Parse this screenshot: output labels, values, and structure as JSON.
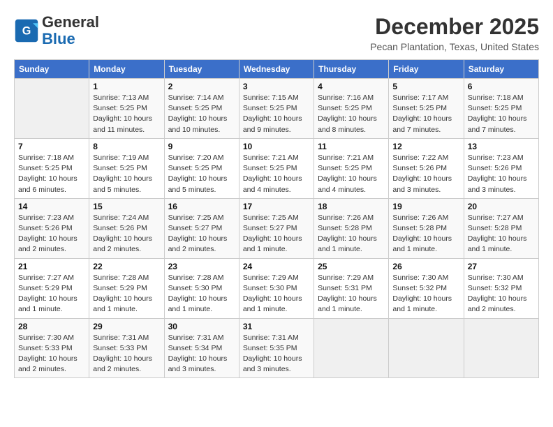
{
  "header": {
    "logo_line1": "General",
    "logo_line2": "Blue",
    "month_year": "December 2025",
    "location": "Pecan Plantation, Texas, United States"
  },
  "days_of_week": [
    "Sunday",
    "Monday",
    "Tuesday",
    "Wednesday",
    "Thursday",
    "Friday",
    "Saturday"
  ],
  "weeks": [
    [
      {
        "day": "",
        "detail": ""
      },
      {
        "day": "1",
        "detail": "Sunrise: 7:13 AM\nSunset: 5:25 PM\nDaylight: 10 hours\nand 11 minutes."
      },
      {
        "day": "2",
        "detail": "Sunrise: 7:14 AM\nSunset: 5:25 PM\nDaylight: 10 hours\nand 10 minutes."
      },
      {
        "day": "3",
        "detail": "Sunrise: 7:15 AM\nSunset: 5:25 PM\nDaylight: 10 hours\nand 9 minutes."
      },
      {
        "day": "4",
        "detail": "Sunrise: 7:16 AM\nSunset: 5:25 PM\nDaylight: 10 hours\nand 8 minutes."
      },
      {
        "day": "5",
        "detail": "Sunrise: 7:17 AM\nSunset: 5:25 PM\nDaylight: 10 hours\nand 7 minutes."
      },
      {
        "day": "6",
        "detail": "Sunrise: 7:18 AM\nSunset: 5:25 PM\nDaylight: 10 hours\nand 7 minutes."
      }
    ],
    [
      {
        "day": "7",
        "detail": "Sunrise: 7:18 AM\nSunset: 5:25 PM\nDaylight: 10 hours\nand 6 minutes."
      },
      {
        "day": "8",
        "detail": "Sunrise: 7:19 AM\nSunset: 5:25 PM\nDaylight: 10 hours\nand 5 minutes."
      },
      {
        "day": "9",
        "detail": "Sunrise: 7:20 AM\nSunset: 5:25 PM\nDaylight: 10 hours\nand 5 minutes."
      },
      {
        "day": "10",
        "detail": "Sunrise: 7:21 AM\nSunset: 5:25 PM\nDaylight: 10 hours\nand 4 minutes."
      },
      {
        "day": "11",
        "detail": "Sunrise: 7:21 AM\nSunset: 5:25 PM\nDaylight: 10 hours\nand 4 minutes."
      },
      {
        "day": "12",
        "detail": "Sunrise: 7:22 AM\nSunset: 5:26 PM\nDaylight: 10 hours\nand 3 minutes."
      },
      {
        "day": "13",
        "detail": "Sunrise: 7:23 AM\nSunset: 5:26 PM\nDaylight: 10 hours\nand 3 minutes."
      }
    ],
    [
      {
        "day": "14",
        "detail": "Sunrise: 7:23 AM\nSunset: 5:26 PM\nDaylight: 10 hours\nand 2 minutes."
      },
      {
        "day": "15",
        "detail": "Sunrise: 7:24 AM\nSunset: 5:26 PM\nDaylight: 10 hours\nand 2 minutes."
      },
      {
        "day": "16",
        "detail": "Sunrise: 7:25 AM\nSunset: 5:27 PM\nDaylight: 10 hours\nand 2 minutes."
      },
      {
        "day": "17",
        "detail": "Sunrise: 7:25 AM\nSunset: 5:27 PM\nDaylight: 10 hours\nand 1 minute."
      },
      {
        "day": "18",
        "detail": "Sunrise: 7:26 AM\nSunset: 5:28 PM\nDaylight: 10 hours\nand 1 minute."
      },
      {
        "day": "19",
        "detail": "Sunrise: 7:26 AM\nSunset: 5:28 PM\nDaylight: 10 hours\nand 1 minute."
      },
      {
        "day": "20",
        "detail": "Sunrise: 7:27 AM\nSunset: 5:28 PM\nDaylight: 10 hours\nand 1 minute."
      }
    ],
    [
      {
        "day": "21",
        "detail": "Sunrise: 7:27 AM\nSunset: 5:29 PM\nDaylight: 10 hours\nand 1 minute."
      },
      {
        "day": "22",
        "detail": "Sunrise: 7:28 AM\nSunset: 5:29 PM\nDaylight: 10 hours\nand 1 minute."
      },
      {
        "day": "23",
        "detail": "Sunrise: 7:28 AM\nSunset: 5:30 PM\nDaylight: 10 hours\nand 1 minute."
      },
      {
        "day": "24",
        "detail": "Sunrise: 7:29 AM\nSunset: 5:30 PM\nDaylight: 10 hours\nand 1 minute."
      },
      {
        "day": "25",
        "detail": "Sunrise: 7:29 AM\nSunset: 5:31 PM\nDaylight: 10 hours\nand 1 minute."
      },
      {
        "day": "26",
        "detail": "Sunrise: 7:30 AM\nSunset: 5:32 PM\nDaylight: 10 hours\nand 1 minute."
      },
      {
        "day": "27",
        "detail": "Sunrise: 7:30 AM\nSunset: 5:32 PM\nDaylight: 10 hours\nand 2 minutes."
      }
    ],
    [
      {
        "day": "28",
        "detail": "Sunrise: 7:30 AM\nSunset: 5:33 PM\nDaylight: 10 hours\nand 2 minutes."
      },
      {
        "day": "29",
        "detail": "Sunrise: 7:31 AM\nSunset: 5:33 PM\nDaylight: 10 hours\nand 2 minutes."
      },
      {
        "day": "30",
        "detail": "Sunrise: 7:31 AM\nSunset: 5:34 PM\nDaylight: 10 hours\nand 3 minutes."
      },
      {
        "day": "31",
        "detail": "Sunrise: 7:31 AM\nSunset: 5:35 PM\nDaylight: 10 hours\nand 3 minutes."
      },
      {
        "day": "",
        "detail": ""
      },
      {
        "day": "",
        "detail": ""
      },
      {
        "day": "",
        "detail": ""
      }
    ]
  ]
}
